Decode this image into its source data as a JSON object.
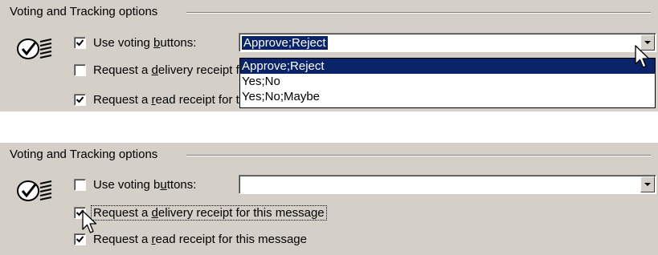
{
  "panels": [
    {
      "group_title": "Voting and Tracking options",
      "use_voting": {
        "label_pre": "Use voting ",
        "label_key": "b",
        "label_post": "uttons:",
        "checked": true
      },
      "delivery_receipt": {
        "label_pre": "Request a ",
        "label_key": "d",
        "label_post": "elivery receipt for this message",
        "checked": false
      },
      "read_receipt": {
        "label_pre": "Request a ",
        "label_key": "r",
        "label_post": "ead receipt for this message",
        "checked": true
      },
      "voting_combo": {
        "value": "Approve;Reject",
        "expanded": true,
        "options": [
          "Approve;Reject",
          "Yes;No",
          "Yes;No;Maybe"
        ],
        "highlighted_index": 0
      }
    },
    {
      "group_title": "Voting and Tracking options",
      "use_voting": {
        "label_pre": "Use voting b",
        "label_key": "u",
        "label_post": "ttons:",
        "checked": false
      },
      "delivery_receipt": {
        "label_pre": "Request a ",
        "label_key": "d",
        "label_post": "elivery receipt for this message",
        "checked": true,
        "focused": true
      },
      "read_receipt": {
        "label_pre": "Request a ",
        "label_key": "r",
        "label_post": "ead receipt for this message",
        "checked": true
      },
      "voting_combo": {
        "value": "",
        "expanded": false
      }
    }
  ],
  "icons": {
    "options_icon": "check-and-list-icon",
    "cursor": "mouse-pointer-icon",
    "dropdown_arrow": "chevron-down-icon"
  },
  "colors": {
    "panel_bg": "#d4d0c8",
    "highlight": "#0a246a"
  }
}
